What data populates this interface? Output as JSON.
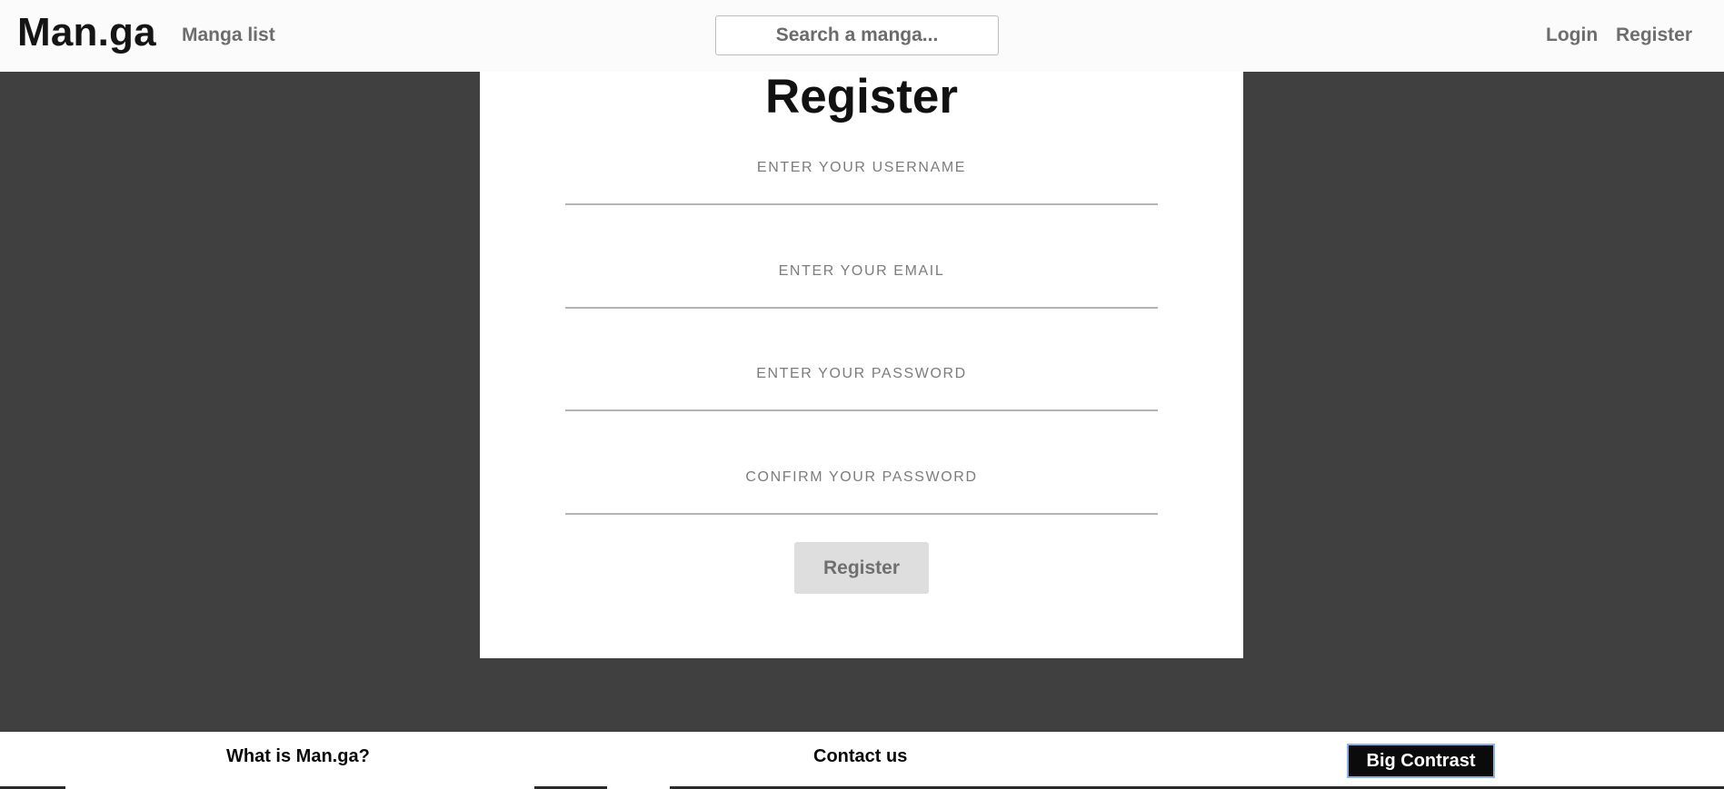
{
  "navbar": {
    "brand": "Man.ga",
    "manga_list": "Manga list",
    "search_placeholder": "Search a manga...",
    "login": "Login",
    "register": "Register"
  },
  "register_form": {
    "title": "Register",
    "username_placeholder": "ENTER YOUR USERNAME",
    "email_placeholder": "ENTER YOUR EMAIL",
    "password_placeholder": "ENTER YOUR PASSWORD",
    "confirm_password_placeholder": "CONFIRM YOUR PASSWORD",
    "submit_label": "Register"
  },
  "footer": {
    "what_is": "What is Man.ga?",
    "contact": "Contact us",
    "big_contrast": "Big Contrast"
  },
  "colors": {
    "page_background": "#404040",
    "navbar_background": "#fbfbfb",
    "card_background": "#ffffff",
    "nav_text": "#6d6d6d",
    "submit_background": "#dedede",
    "contrast_button_background": "#0b0b0b",
    "contrast_button_focus_ring": "#8fb1e6"
  }
}
